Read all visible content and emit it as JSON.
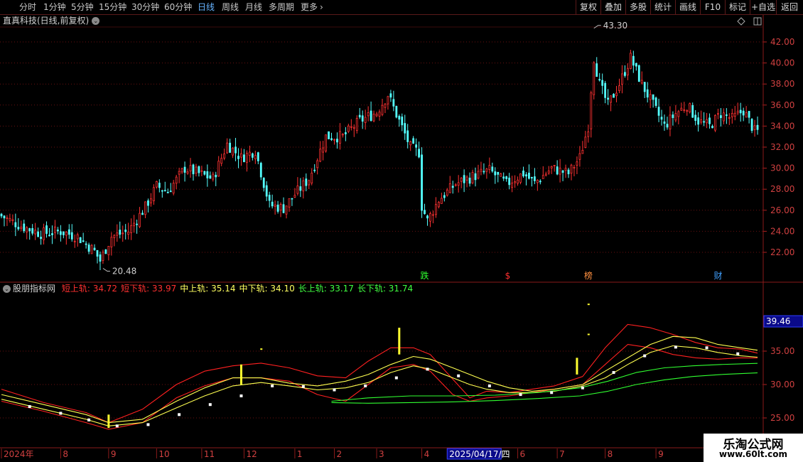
{
  "toolbar": {
    "timeframes": [
      "分时",
      "1分钟",
      "5分钟",
      "15分钟",
      "30分钟",
      "60分钟",
      "日线",
      "周线",
      "月线",
      "多周期",
      "更多"
    ],
    "active": "日线",
    "right_buttons": [
      "复权",
      "叠加",
      "多股",
      "统计",
      "画线",
      "F10",
      "标记",
      "+自选",
      "返回"
    ]
  },
  "stock_header": "直真科技(日线,前复权)",
  "indicator": {
    "name": "股朋指标网",
    "items": [
      {
        "label": "短上轨",
        "value": "34.72",
        "color": "#ff3030"
      },
      {
        "label": "短下轨",
        "value": "33.97",
        "color": "#ff3030"
      },
      {
        "label": "中上轨",
        "value": "35.14",
        "color": "#ffff60"
      },
      {
        "label": "中下轨",
        "value": "34.10",
        "color": "#ffff60"
      },
      {
        "label": "长上轨",
        "value": "33.17",
        "color": "#40ff40"
      },
      {
        "label": "长下轨",
        "value": "31.74",
        "color": "#40ff40"
      }
    ],
    "yaxis_ticks": [
      "35.00",
      "30.00",
      "25.00"
    ],
    "current_value": "39.46"
  },
  "watermark": {
    "line1": "乐淘公式网",
    "line2": "www.60lt.com"
  },
  "chart_data": {
    "type": "candlestick",
    "price_axis_ticks": [
      "42.00",
      "40.00",
      "38.00",
      "36.00",
      "34.00",
      "32.00",
      "30.00",
      "28.00",
      "26.00",
      "24.00",
      "22.00"
    ],
    "ylim": [
      20.0,
      44.0
    ],
    "high_label": "43.30",
    "low_label": "20.48",
    "date_labels": [
      "2024年",
      "8",
      "9",
      "10",
      "11",
      "12",
      "1",
      "2",
      "3",
      "4",
      "2025/04/17/四",
      "6",
      "7",
      "8",
      "9"
    ],
    "event_markers": [
      {
        "text": "跌",
        "color": "#30ff30"
      },
      {
        "text": "$",
        "color": "#ff3030"
      },
      {
        "text": "榜",
        "color": "#ff9040"
      },
      {
        "text": "财",
        "color": "#40a0ff"
      }
    ],
    "price_anchors": [
      [
        0,
        25.6
      ],
      [
        8,
        24.5
      ],
      [
        15,
        23.8
      ],
      [
        22,
        24.0
      ],
      [
        28,
        23.5
      ],
      [
        34,
        22.1
      ],
      [
        36,
        21.2
      ],
      [
        40,
        23.5
      ],
      [
        46,
        24.0
      ],
      [
        52,
        26.3
      ],
      [
        56,
        28.3
      ],
      [
        60,
        27.8
      ],
      [
        66,
        30.0
      ],
      [
        72,
        29.4
      ],
      [
        76,
        29.0
      ],
      [
        81,
        32.3
      ],
      [
        86,
        31.0
      ],
      [
        91,
        31.7
      ],
      [
        96,
        26.5
      ],
      [
        101,
        26.2
      ],
      [
        105,
        27.5
      ],
      [
        110,
        29.0
      ],
      [
        116,
        33.0
      ],
      [
        122,
        33.0
      ],
      [
        128,
        34.5
      ],
      [
        134,
        35.3
      ],
      [
        138,
        37.0
      ],
      [
        142,
        34.5
      ],
      [
        146,
        32.0
      ],
      [
        149,
        31.5
      ],
      [
        150,
        26.4
      ],
      [
        152,
        25.0
      ],
      [
        156,
        27.0
      ],
      [
        162,
        28.5
      ],
      [
        168,
        29.2
      ],
      [
        174,
        29.8
      ],
      [
        180,
        28.5
      ],
      [
        186,
        29.5
      ],
      [
        190,
        28.6
      ],
      [
        196,
        30.0
      ],
      [
        202,
        29.5
      ],
      [
        206,
        31.0
      ],
      [
        209,
        34.0
      ],
      [
        210,
        37.5
      ],
      [
        211,
        40.5
      ],
      [
        213,
        38.0
      ],
      [
        216,
        36.0
      ],
      [
        220,
        38.0
      ],
      [
        224,
        40.5
      ],
      [
        228,
        38.0
      ],
      [
        232,
        36.0
      ],
      [
        236,
        34.0
      ],
      [
        240,
        35.2
      ],
      [
        244,
        36.0
      ],
      [
        248,
        34.5
      ],
      [
        252,
        34.0
      ],
      [
        256,
        35.2
      ],
      [
        260,
        34.7
      ],
      [
        264,
        35.5
      ],
      [
        268,
        33.5
      ]
    ],
    "series": [
      {
        "name": "短上轨",
        "color": "#ff2020",
        "values": [
          [
            0,
            29.3
          ],
          [
            15,
            27.3
          ],
          [
            30,
            25.8
          ],
          [
            38,
            24.3
          ],
          [
            50,
            26.3
          ],
          [
            62,
            30.0
          ],
          [
            72,
            32.0
          ],
          [
            82,
            32.8
          ],
          [
            92,
            33.2
          ],
          [
            102,
            32.5
          ],
          [
            112,
            31.3
          ],
          [
            122,
            31.0
          ],
          [
            130,
            33.5
          ],
          [
            138,
            35.5
          ],
          [
            146,
            35.5
          ],
          [
            152,
            34.5
          ],
          [
            160,
            30.8
          ],
          [
            166,
            28.0
          ],
          [
            172,
            29.0
          ],
          [
            180,
            28.8
          ],
          [
            188,
            29.3
          ],
          [
            196,
            29.8
          ],
          [
            206,
            31.2
          ],
          [
            214,
            35.5
          ],
          [
            222,
            39.0
          ],
          [
            230,
            38.5
          ],
          [
            238,
            37.5
          ],
          [
            246,
            36.3
          ],
          [
            254,
            35.5
          ],
          [
            262,
            35.3
          ],
          [
            268,
            34.7
          ]
        ]
      },
      {
        "name": "短下轨",
        "color": "#ff2020",
        "values": [
          [
            0,
            27.5
          ],
          [
            15,
            26.0
          ],
          [
            30,
            24.3
          ],
          [
            38,
            23.3
          ],
          [
            50,
            24.3
          ],
          [
            62,
            28.0
          ],
          [
            72,
            29.8
          ],
          [
            82,
            31.0
          ],
          [
            92,
            31.0
          ],
          [
            102,
            30.5
          ],
          [
            112,
            28.5
          ],
          [
            122,
            27.5
          ],
          [
            130,
            30.0
          ],
          [
            138,
            32.5
          ],
          [
            146,
            33.0
          ],
          [
            152,
            32.0
          ],
          [
            160,
            28.5
          ],
          [
            166,
            27.5
          ],
          [
            172,
            28.0
          ],
          [
            180,
            28.3
          ],
          [
            188,
            28.8
          ],
          [
            196,
            29.3
          ],
          [
            206,
            30.0
          ],
          [
            214,
            33.0
          ],
          [
            222,
            36.0
          ],
          [
            230,
            35.5
          ],
          [
            238,
            34.5
          ],
          [
            246,
            34.0
          ],
          [
            254,
            33.8
          ],
          [
            262,
            34.0
          ],
          [
            268,
            33.97
          ]
        ]
      },
      {
        "name": "中上轨",
        "color": "#ffff50",
        "values": [
          [
            0,
            28.5
          ],
          [
            15,
            27.0
          ],
          [
            30,
            25.5
          ],
          [
            38,
            24.3
          ],
          [
            50,
            24.8
          ],
          [
            62,
            27.5
          ],
          [
            72,
            29.5
          ],
          [
            82,
            31.0
          ],
          [
            92,
            31.0
          ],
          [
            102,
            30.2
          ],
          [
            112,
            29.8
          ],
          [
            122,
            30.5
          ],
          [
            130,
            31.5
          ],
          [
            138,
            33.0
          ],
          [
            146,
            34.2
          ],
          [
            152,
            33.8
          ],
          [
            160,
            32.5
          ],
          [
            166,
            31.5
          ],
          [
            172,
            30.5
          ],
          [
            180,
            29.5
          ],
          [
            188,
            29.0
          ],
          [
            196,
            29.3
          ],
          [
            206,
            30.0
          ],
          [
            214,
            32.0
          ],
          [
            222,
            34.0
          ],
          [
            230,
            36.0
          ],
          [
            238,
            37.2
          ],
          [
            246,
            37.0
          ],
          [
            254,
            36.0
          ],
          [
            262,
            35.5
          ],
          [
            268,
            35.14
          ]
        ]
      },
      {
        "name": "中下轨",
        "color": "#ffff50",
        "values": [
          [
            0,
            27.8
          ],
          [
            15,
            26.3
          ],
          [
            30,
            24.8
          ],
          [
            38,
            23.8
          ],
          [
            50,
            24.3
          ],
          [
            62,
            26.5
          ],
          [
            72,
            28.3
          ],
          [
            82,
            29.8
          ],
          [
            92,
            30.3
          ],
          [
            102,
            29.8
          ],
          [
            112,
            29.2
          ],
          [
            122,
            29.5
          ],
          [
            130,
            30.3
          ],
          [
            138,
            31.8
          ],
          [
            146,
            32.8
          ],
          [
            152,
            32.3
          ],
          [
            160,
            31.0
          ],
          [
            166,
            30.0
          ],
          [
            172,
            29.3
          ],
          [
            180,
            28.8
          ],
          [
            188,
            28.8
          ],
          [
            196,
            29.0
          ],
          [
            206,
            29.8
          ],
          [
            214,
            31.0
          ],
          [
            222,
            33.0
          ],
          [
            230,
            34.8
          ],
          [
            238,
            35.8
          ],
          [
            246,
            35.5
          ],
          [
            254,
            34.8
          ],
          [
            262,
            34.3
          ],
          [
            268,
            34.1
          ]
        ]
      },
      {
        "name": "长上轨",
        "color": "#30ff30",
        "values": [
          [
            117,
            27.5
          ],
          [
            130,
            28.0
          ],
          [
            145,
            28.3
          ],
          [
            160,
            28.3
          ],
          [
            175,
            28.4
          ],
          [
            190,
            28.8
          ],
          [
            205,
            29.5
          ],
          [
            215,
            30.5
          ],
          [
            225,
            31.8
          ],
          [
            235,
            32.5
          ],
          [
            245,
            32.8
          ],
          [
            255,
            33.0
          ],
          [
            268,
            33.17
          ]
        ]
      },
      {
        "name": "长下轨",
        "color": "#30ff30",
        "values": [
          [
            117,
            27.3
          ],
          [
            130,
            27.2
          ],
          [
            145,
            27.3
          ],
          [
            160,
            27.4
          ],
          [
            175,
            27.6
          ],
          [
            190,
            27.9
          ],
          [
            205,
            28.3
          ],
          [
            215,
            29.0
          ],
          [
            225,
            30.0
          ],
          [
            235,
            30.7
          ],
          [
            245,
            31.2
          ],
          [
            255,
            31.5
          ],
          [
            268,
            31.74
          ]
        ]
      }
    ],
    "signal_bars": [
      {
        "x": 38,
        "y0": 23.5,
        "y1": 25.5
      },
      {
        "x": 85,
        "y0": 30.0,
        "y1": 33.0
      },
      {
        "x": 141,
        "y0": 34.5,
        "y1": 38.5
      },
      {
        "x": 204,
        "y0": 31.5,
        "y1": 34.0
      }
    ],
    "signal_dots": [
      {
        "x": 92,
        "y": 35.3
      },
      {
        "x": 208,
        "y": 37.5
      },
      {
        "x": 208,
        "y": 42.0
      }
    ],
    "markers": [
      [
        10,
        26.7
      ],
      [
        21,
        25.7
      ],
      [
        31,
        24.7
      ],
      [
        41,
        23.8
      ],
      [
        52,
        24.0
      ],
      [
        63,
        25.5
      ],
      [
        74,
        27.0
      ],
      [
        85,
        28.3
      ],
      [
        96,
        29.8
      ],
      [
        107,
        29.7
      ],
      [
        118,
        29.2
      ],
      [
        129,
        29.8
      ],
      [
        140,
        31.0
      ],
      [
        151,
        32.3
      ],
      [
        162,
        31.3
      ],
      [
        173,
        29.8
      ],
      [
        184,
        28.5
      ],
      [
        195,
        28.8
      ],
      [
        206,
        29.5
      ],
      [
        217,
        31.8
      ],
      [
        228,
        34.3
      ],
      [
        239,
        35.6
      ],
      [
        250,
        35.5
      ],
      [
        261,
        34.6
      ]
    ]
  }
}
